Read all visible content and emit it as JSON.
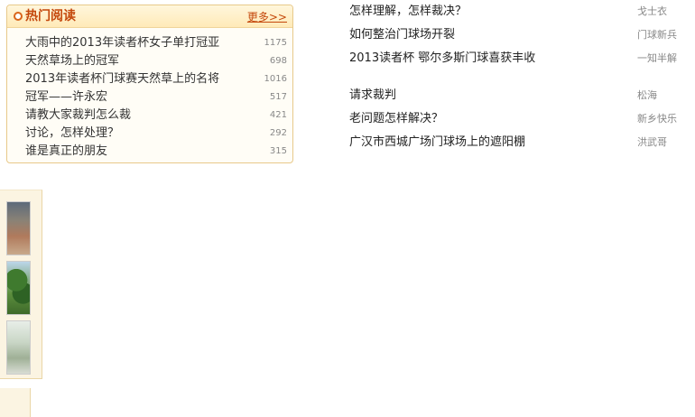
{
  "hot_reading": {
    "title": "热门阅读",
    "more_label": "更多>>",
    "items": [
      {
        "title": "大雨中的2013年读者杯女子单打冠亚",
        "count": "1175"
      },
      {
        "title": "天然草场上的冠军",
        "count": "698"
      },
      {
        "title": "2013年读者杯门球赛天然草上的名将",
        "count": "1016"
      },
      {
        "title": "冠军——许永宏",
        "count": "517"
      },
      {
        "title": "请教大家裁判怎么裁",
        "count": "421"
      },
      {
        "title": "讨论，怎样处理？",
        "count": "292"
      },
      {
        "title": "谁是真正的朋友",
        "count": "315"
      }
    ]
  },
  "topics": [
    {
      "title": "怎样理解，怎样裁决？",
      "author": "戈士衣"
    },
    {
      "title": "如何整治门球场开裂",
      "author": "门球新兵"
    },
    {
      "title": "2013读者杯 鄂尔多斯门球喜获丰收",
      "author": "一知半解"
    },
    {
      "title": "请求裁判",
      "author": "松海"
    },
    {
      "title": "老问题怎样解决？",
      "author": "新乡快乐"
    },
    {
      "title": "广汉市西城广场门球场上的遮阳棚",
      "author": "洪武哥"
    }
  ],
  "photos": [
    "photo-1",
    "photo-2",
    "photo-3"
  ],
  "colors": {
    "accent": "#c4470b",
    "box_border": "#e8c98a",
    "header_bg": "#ffeab8"
  }
}
